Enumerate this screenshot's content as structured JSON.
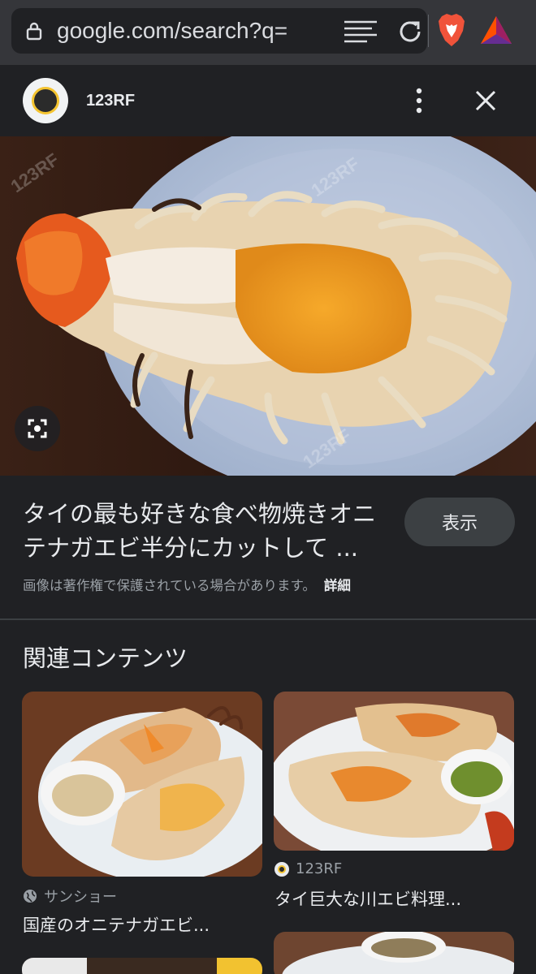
{
  "browser": {
    "url": "google.com/search?q="
  },
  "source": {
    "name": "123RF"
  },
  "result": {
    "title": "タイの最も好きな食べ物焼きオニテナガエビ半分にカットして ...",
    "view_label": "表示",
    "copyright_notice": "画像は著作権で保護されている場合があります。",
    "details_label": "詳細"
  },
  "related": {
    "heading": "関連コンテンツ",
    "cards": [
      {
        "source": "サンショー",
        "title": "国産のオニテナガエビ..."
      },
      {
        "source": "123RF",
        "title": "タイ巨大な川エビ料理..."
      }
    ]
  },
  "colors": {
    "background": "#202124",
    "toolbar": "#35363a",
    "text_primary": "#e8eaed",
    "text_secondary": "#9aa0a6",
    "button": "#3c4043"
  }
}
